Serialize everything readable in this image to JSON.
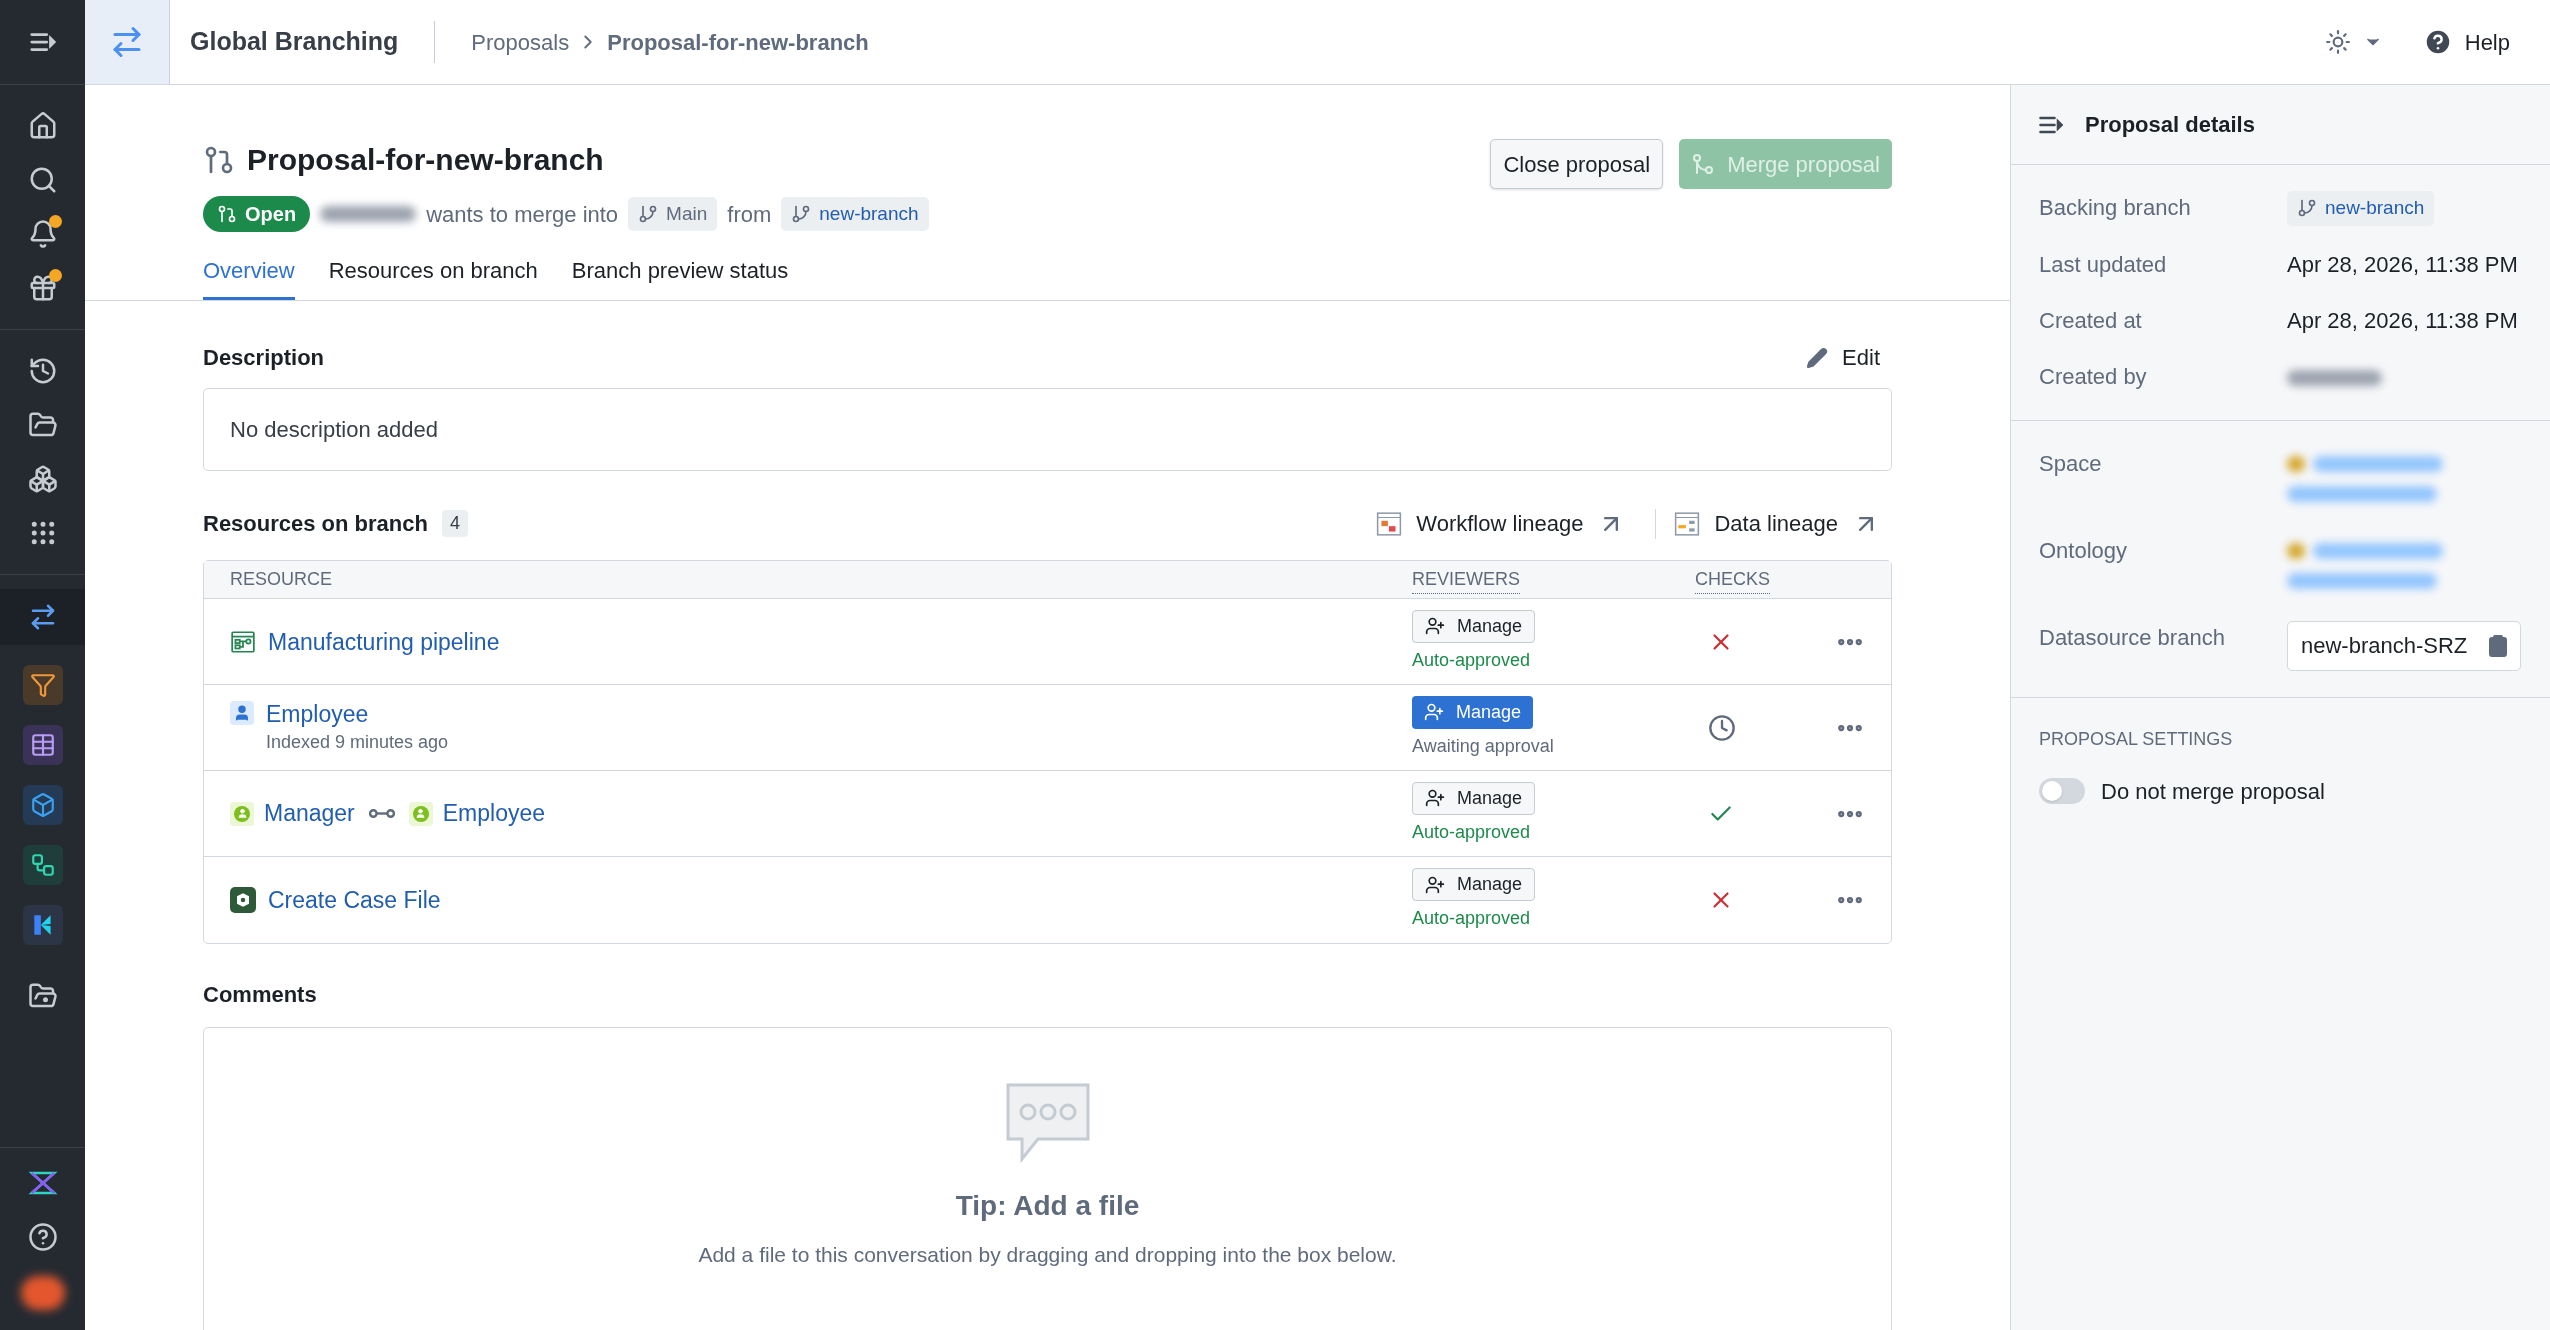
{
  "app": {
    "name": "Global Branching"
  },
  "breadcrumbs": [
    {
      "label": "Proposals",
      "current": false
    },
    {
      "label": "Proposal-for-new-branch",
      "current": true
    }
  ],
  "header": {
    "help": "Help"
  },
  "proposal": {
    "title": "Proposal-for-new-branch",
    "status": "Open",
    "merge_text": "wants to merge into",
    "target_branch": "Main",
    "from_text": "from",
    "source_branch": "new-branch"
  },
  "actions": [
    {
      "label": "Close proposal",
      "kind": "secondary",
      "disabled": false
    },
    {
      "label": "Merge proposal",
      "kind": "merge",
      "disabled": true
    }
  ],
  "tabs": [
    {
      "label": "Overview",
      "selected": true
    },
    {
      "label": "Resources on branch",
      "selected": false
    },
    {
      "label": "Branch preview status",
      "selected": false
    }
  ],
  "description": {
    "heading": "Description",
    "edit": "Edit",
    "text": "No description added"
  },
  "resources": {
    "heading": "Resources on branch",
    "count": "4",
    "links": [
      {
        "label": "Workflow lineage",
        "kind": "workflow"
      },
      {
        "label": "Data lineage",
        "kind": "data"
      }
    ],
    "columns": [
      "RESOURCE",
      "REVIEWERS",
      "CHECKS"
    ],
    "rows": [
      {
        "kind": "pipeline",
        "names": [
          "Manufacturing pipeline"
        ],
        "manage": "Manage",
        "manage_primary": false,
        "review": "Auto-approved",
        "approved": true,
        "check": {
          "kind": "failed"
        }
      },
      {
        "kind": "object",
        "names": [
          "Employee"
        ],
        "subtitle": "Indexed 9 minutes ago",
        "manage": "Manage",
        "manage_primary": true,
        "review": "Awaiting approval",
        "approved": false,
        "check": {
          "kind": "pending"
        }
      },
      {
        "kind": "link",
        "names": [
          "Manager",
          "Employee"
        ],
        "manage": "Manage",
        "manage_primary": false,
        "review": "Auto-approved",
        "approved": true,
        "check": {
          "kind": "passed"
        }
      },
      {
        "kind": "action",
        "names": [
          "Create Case File"
        ],
        "manage": "Manage",
        "manage_primary": false,
        "review": "Auto-approved",
        "approved": true,
        "check": {
          "kind": "failed"
        }
      }
    ]
  },
  "comments": {
    "heading": "Comments",
    "tip_title": "Tip: Add a file",
    "tip_text": "Add a file to this conversation by dragging and dropping into the box below."
  },
  "details": {
    "title": "Proposal details",
    "sections": [
      [
        {
          "label": "Backing branch",
          "kind": "branch",
          "value": "new-branch"
        },
        {
          "label": "Last updated",
          "kind": "text",
          "value": "Apr 28, 2026, 11:38 PM"
        },
        {
          "label": "Created at",
          "kind": "text",
          "value": "Apr 28, 2026, 11:38 PM"
        },
        {
          "label": "Created by",
          "kind": "redacted"
        }
      ],
      [
        {
          "label": "Space",
          "kind": "redacted_link"
        },
        {
          "label": "Ontology",
          "kind": "redacted_link"
        },
        {
          "label": "Datasource branch",
          "kind": "copy",
          "value": "new-branch-SRZ"
        }
      ]
    ],
    "settings_heading": "PROPOSAL SETTINGS",
    "toggles": [
      {
        "label": "Do not merge proposal",
        "on": false
      }
    ]
  }
}
